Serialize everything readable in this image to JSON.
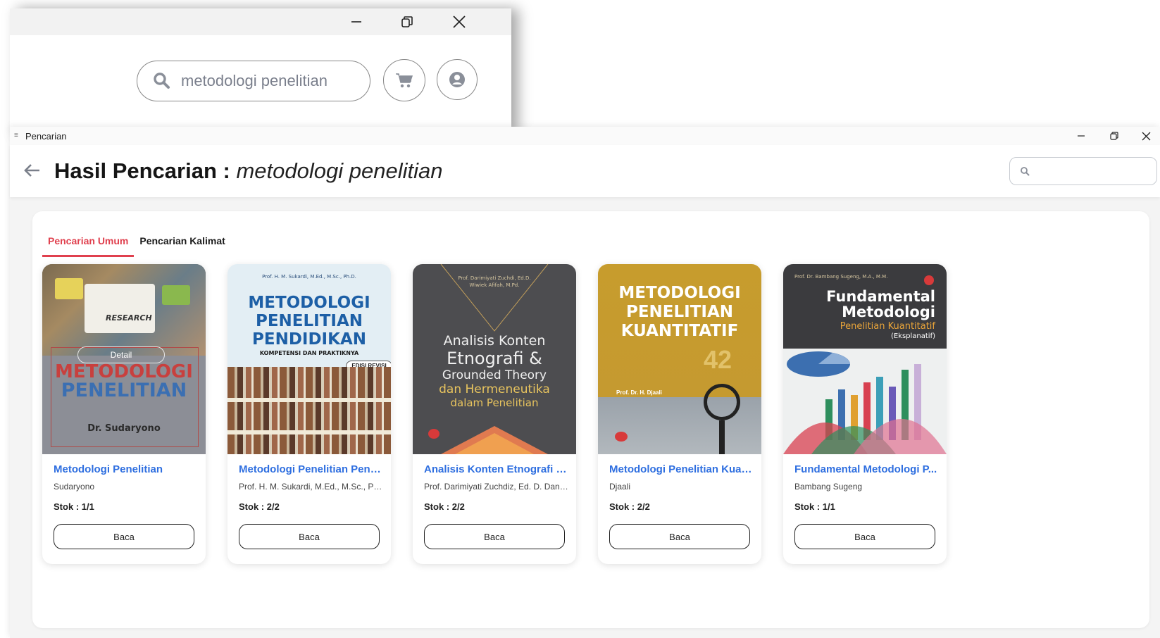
{
  "back_window": {
    "search_value": "metodologi penelitian",
    "icons": [
      "search-icon",
      "cart-icon",
      "user-icon"
    ]
  },
  "front_window": {
    "title": "Pencarian",
    "header": {
      "heading_label": "Hasil Pencarian :",
      "heading_query": "metodologi penelitian"
    },
    "tabs": [
      {
        "label": "Pencarian Umum",
        "active": true
      },
      {
        "label": "Pencarian Kalimat",
        "active": false
      }
    ],
    "books": [
      {
        "title": "Metodologi Penelitian",
        "author": "Sudaryono",
        "stock": "Stok : 1/1",
        "button": "Baca",
        "cover": {
          "overlay_button": "Detail",
          "line1": "METODOLOGI",
          "line2": "PENELITIAN",
          "author": "Dr. Sudaryono",
          "note": "RESEARCH"
        }
      },
      {
        "title": "Metodologi Penelitian Pend...",
        "author": "Prof. H. M. Sukardi, M.Ed., M.Sc., Ph.D.",
        "stock": "Stok : 2/2",
        "button": "Baca",
        "cover": {
          "top": "Prof. H. M. Sukardi, M.Ed., M.Sc., Ph.D.",
          "line1": "METODOLOGI",
          "line2": "PENELITIAN",
          "line3": "PENDIDIKAN",
          "sub": "KOMPETENSI DAN PRAKTIKNYA",
          "badge": "EDISI REVISI"
        }
      },
      {
        "title": "Analisis Konten Etnografi & ...",
        "author": "Prof. Darimiyati Zuchdiz, Ed. D. Dan ...",
        "stock": "Stok : 2/2",
        "button": "Baca",
        "cover": {
          "top": "Prof. Darimiyati Zuchdi, Ed.D.",
          "top2": "Wiwiek Afifah, M.Pd.",
          "line1": "Analisis Konten",
          "line2": "Etnografi &",
          "line3": "Grounded Theory",
          "line4": "dan Hermeneutika",
          "line5": "dalam Penelitian"
        }
      },
      {
        "title": "Metodologi Penelitian Kuan...",
        "author": "Djaali",
        "stock": "Stok : 2/2",
        "button": "Baca",
        "cover": {
          "line1": "METODOLOGI",
          "line2": "PENELITIAN",
          "line3": "KUANTITATIF",
          "author": "Prof. Dr. H. Djaali"
        }
      },
      {
        "title": "Fundamental Metodologi P...",
        "author": "Bambang Sugeng",
        "stock": "Stok : 1/1",
        "button": "Baca",
        "cover": {
          "top": "Prof. Dr. Bambang Sugeng, M.A., M.M.",
          "line1": "Fundamental",
          "line2": "Metodologi",
          "line3": "Penelitian Kuantitatif",
          "line4": "(Eksplanatif)"
        }
      }
    ]
  },
  "colors": {
    "accent_red": "#e0404e",
    "link_blue": "#2f6fe0"
  }
}
